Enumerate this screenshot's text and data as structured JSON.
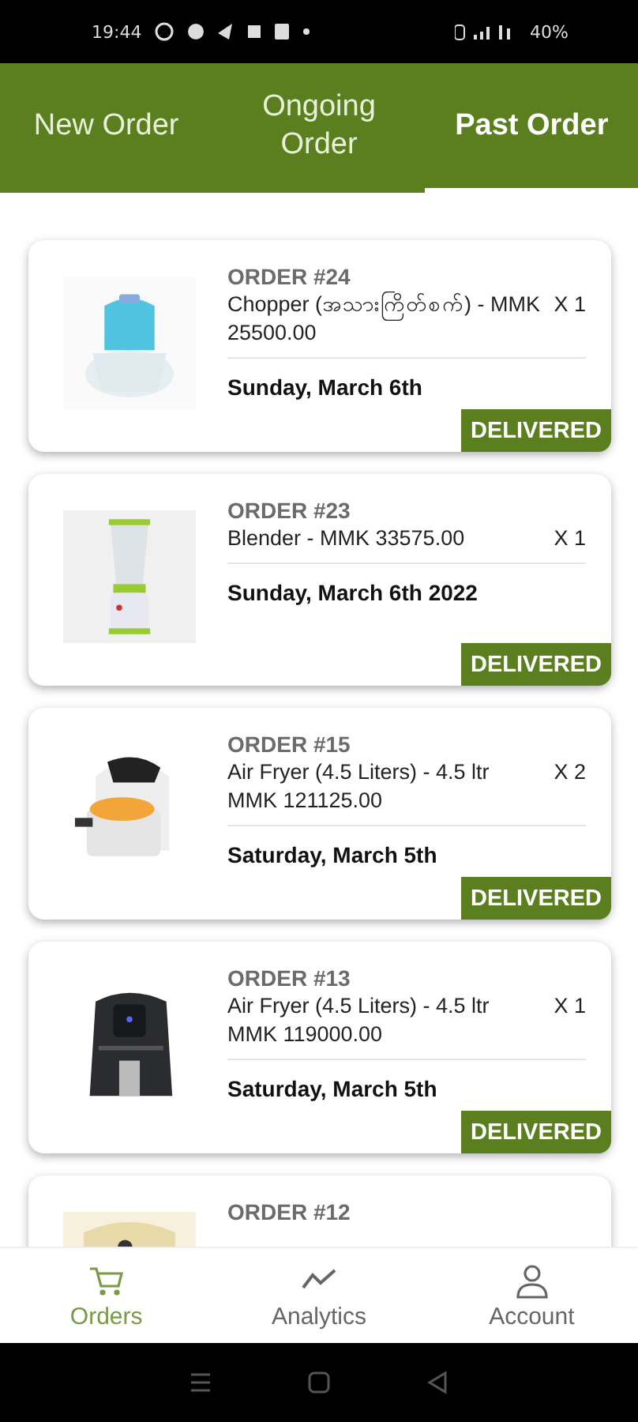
{
  "status_bar": {
    "time": "19:44",
    "battery": "40%"
  },
  "tabs": [
    {
      "label": "New Order",
      "selected": false
    },
    {
      "label": "Ongoing Order",
      "selected": false
    },
    {
      "label": "Past Order",
      "selected": true
    }
  ],
  "orders": [
    {
      "number": "ORDER #24",
      "item": "Chopper (အသားကြိတ်စက်) - MMK 25500.00",
      "quantity": "X 1",
      "date": "Sunday, March 6th",
      "status": "DELIVERED"
    },
    {
      "number": "ORDER #23",
      "item": "Blender - MMK 33575.00",
      "quantity": "X 1",
      "date": "Sunday, March 6th 2022",
      "status": "DELIVERED"
    },
    {
      "number": "ORDER #15",
      "item": "Air Fryer (4.5 Liters) - 4.5 ltr MMK 121125.00",
      "quantity": "X 2",
      "date": "Saturday, March 5th",
      "status": "DELIVERED"
    },
    {
      "number": "ORDER #13",
      "item": "Air Fryer (4.5 Liters) - 4.5 ltr MMK 119000.00",
      "quantity": "X 1",
      "date": "Saturday, March 5th",
      "status": "DELIVERED"
    },
    {
      "number": "ORDER #12"
    }
  ],
  "bottom_nav": [
    {
      "label": "Orders",
      "selected": true
    },
    {
      "label": "Analytics",
      "selected": false
    },
    {
      "label": "Account",
      "selected": false
    }
  ]
}
